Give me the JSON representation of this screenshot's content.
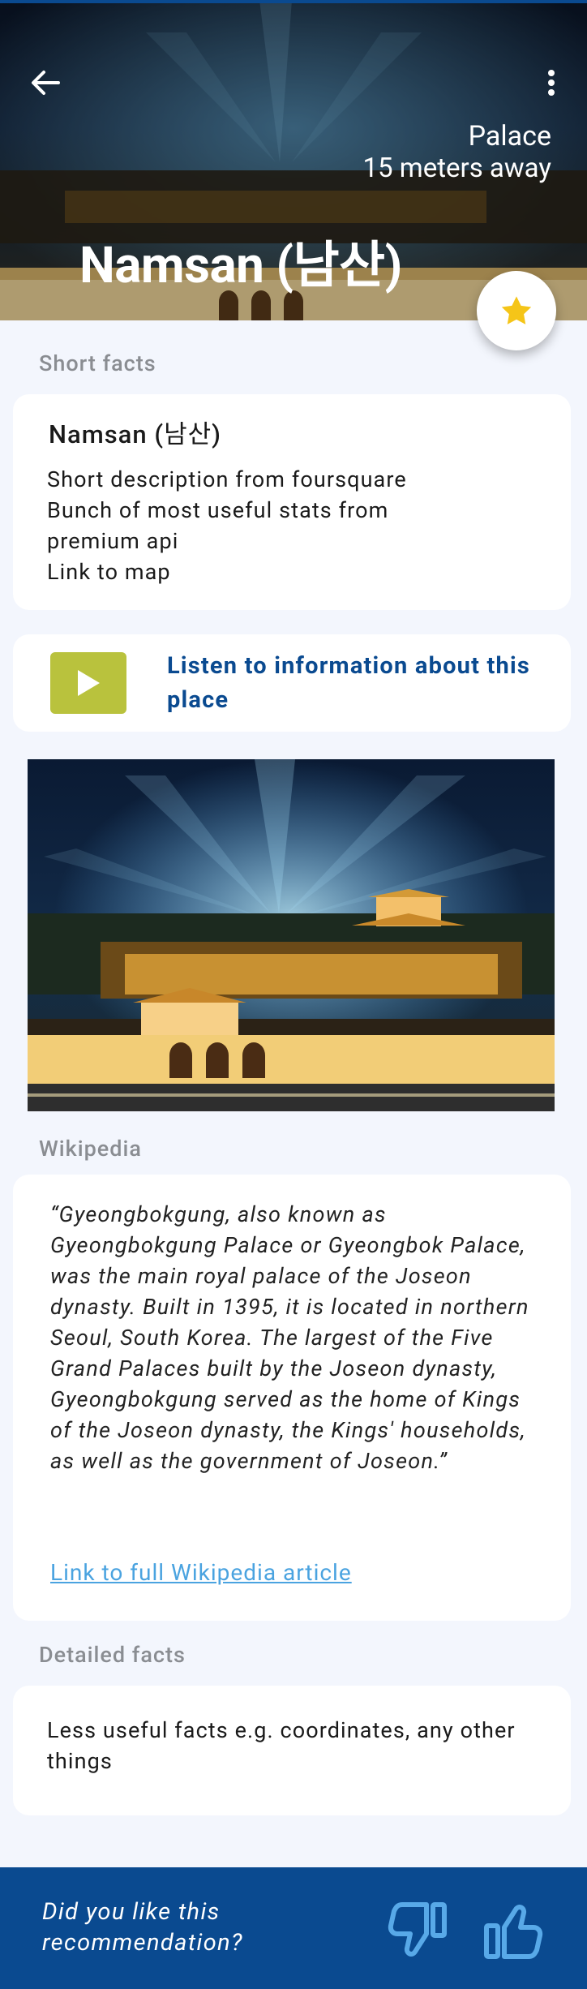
{
  "header": {
    "back_icon": "arrow-left-icon",
    "menu_icon": "more-vert-icon",
    "category": "Palace",
    "distance": "15 meters away",
    "title": "Namsan (남산)",
    "favorite_icon": "star-icon",
    "favorite_color": "#f5c518"
  },
  "short_facts": {
    "section_label": "Short facts",
    "card_title": "Namsan (남산)",
    "lines": [
      "Short description from foursquare",
      "Bunch of most useful stats from",
      "premium api",
      "Link to map"
    ]
  },
  "audio": {
    "play_icon": "play-icon",
    "play_color": "#b9c23d",
    "label": "Listen to information about this place"
  },
  "photo": {
    "alt_icon": "palace-night-photo"
  },
  "wikipedia": {
    "section_label": "Wikipedia",
    "quote": "“Gyeongbokgung, also known as Gyeongbokgung Palace or Gyeongbok Palace, was the main royal palace of the Joseon dynasty. Built in 1395, it is located in northern Seoul, South Korea. The largest of the Five Grand Palaces built by the Joseon dynasty, Gyeongbokgung served as the home of Kings of the Joseon dynasty, the Kings' households, as well as the government of Joseon.”",
    "link_label": "Link to full Wikipedia article"
  },
  "detailed_facts": {
    "section_label": "Detailed facts",
    "text": "Less useful facts e.g. coordinates, any other things"
  },
  "feedback": {
    "question": "Did you like this recommendation?",
    "dislike_icon": "thumbs-down-icon",
    "like_icon": "thumbs-up-icon",
    "bar_color": "#0a4a90"
  }
}
